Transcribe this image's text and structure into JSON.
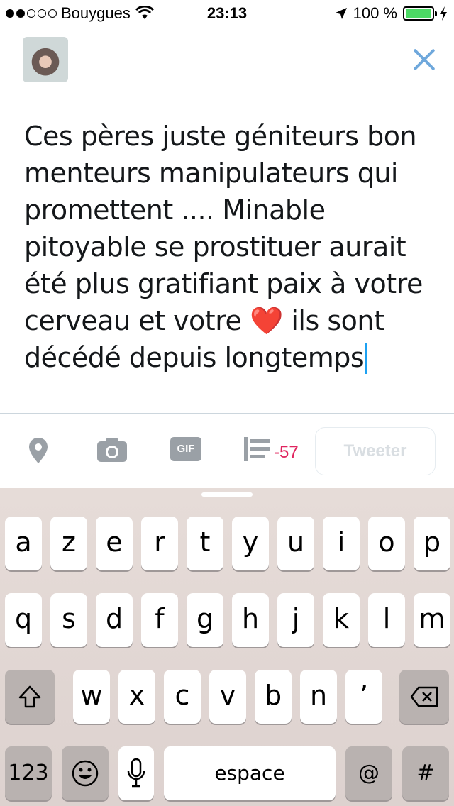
{
  "status_bar": {
    "carrier": "Bouygues",
    "time": "23:13",
    "battery": "100 %",
    "battery_level": 1.0,
    "signal_dots_filled": 2,
    "signal_dots_total": 5
  },
  "compose": {
    "text": "Ces pères juste géniteurs bon menteurs manipulateurs qui promettent .... Minable pitoyable se prostituer aurait été plus gratifiant paix à votre cerveau et votre ❤️ ils sont décédé depuis longtemps",
    "close_icon": "close-icon",
    "accent_color": "#1da1f2"
  },
  "toolbar": {
    "gif_label": "GIF",
    "char_count": "-57",
    "char_count_color": "#e0245e",
    "tweet_label": "Tweeter"
  },
  "keyboard": {
    "row1": [
      "a",
      "z",
      "e",
      "r",
      "t",
      "y",
      "u",
      "i",
      "o",
      "p"
    ],
    "row2": [
      "q",
      "s",
      "d",
      "f",
      "g",
      "h",
      "j",
      "k",
      "l",
      "m"
    ],
    "row3": [
      "w",
      "x",
      "c",
      "v",
      "b",
      "n",
      "’"
    ],
    "numbers_label": "123",
    "space_label": "espace",
    "at_label": "@",
    "hash_label": "#",
    "emoji_icon": "emoji-icon",
    "mic_icon": "microphone-icon",
    "shift_icon": "shift-icon",
    "delete_icon": "delete-icon"
  }
}
